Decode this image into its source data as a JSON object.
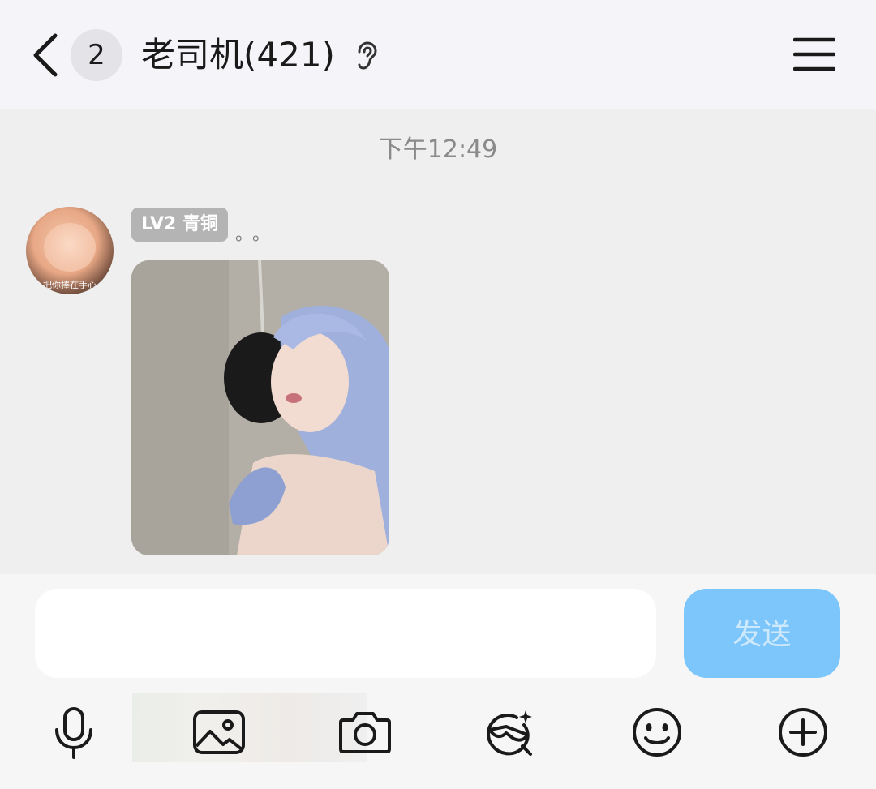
{
  "header": {
    "unread_count": "2",
    "title": "老司机(421)",
    "icons": {
      "back": "back-chevron-icon",
      "mode": "ear-icon",
      "menu": "menu-icon"
    }
  },
  "chat": {
    "timestamp": "下午12:49",
    "messages": [
      {
        "sender_level": "LV2 青铜",
        "sender_name": "。。",
        "avatar_caption": "把你捧在手心",
        "content_type": "image"
      }
    ]
  },
  "composer": {
    "input_value": "",
    "input_placeholder": "",
    "send_label": "发送"
  },
  "toolbar": {
    "items": [
      "microphone-icon",
      "image-icon",
      "camera-icon",
      "cool-face-icon",
      "smiley-icon",
      "plus-icon"
    ]
  },
  "colors": {
    "header_bg": "#f5f4f8",
    "chat_bg": "#efefef",
    "send_button": "#7cc6fb",
    "level_badge": "#b4b4b4"
  }
}
